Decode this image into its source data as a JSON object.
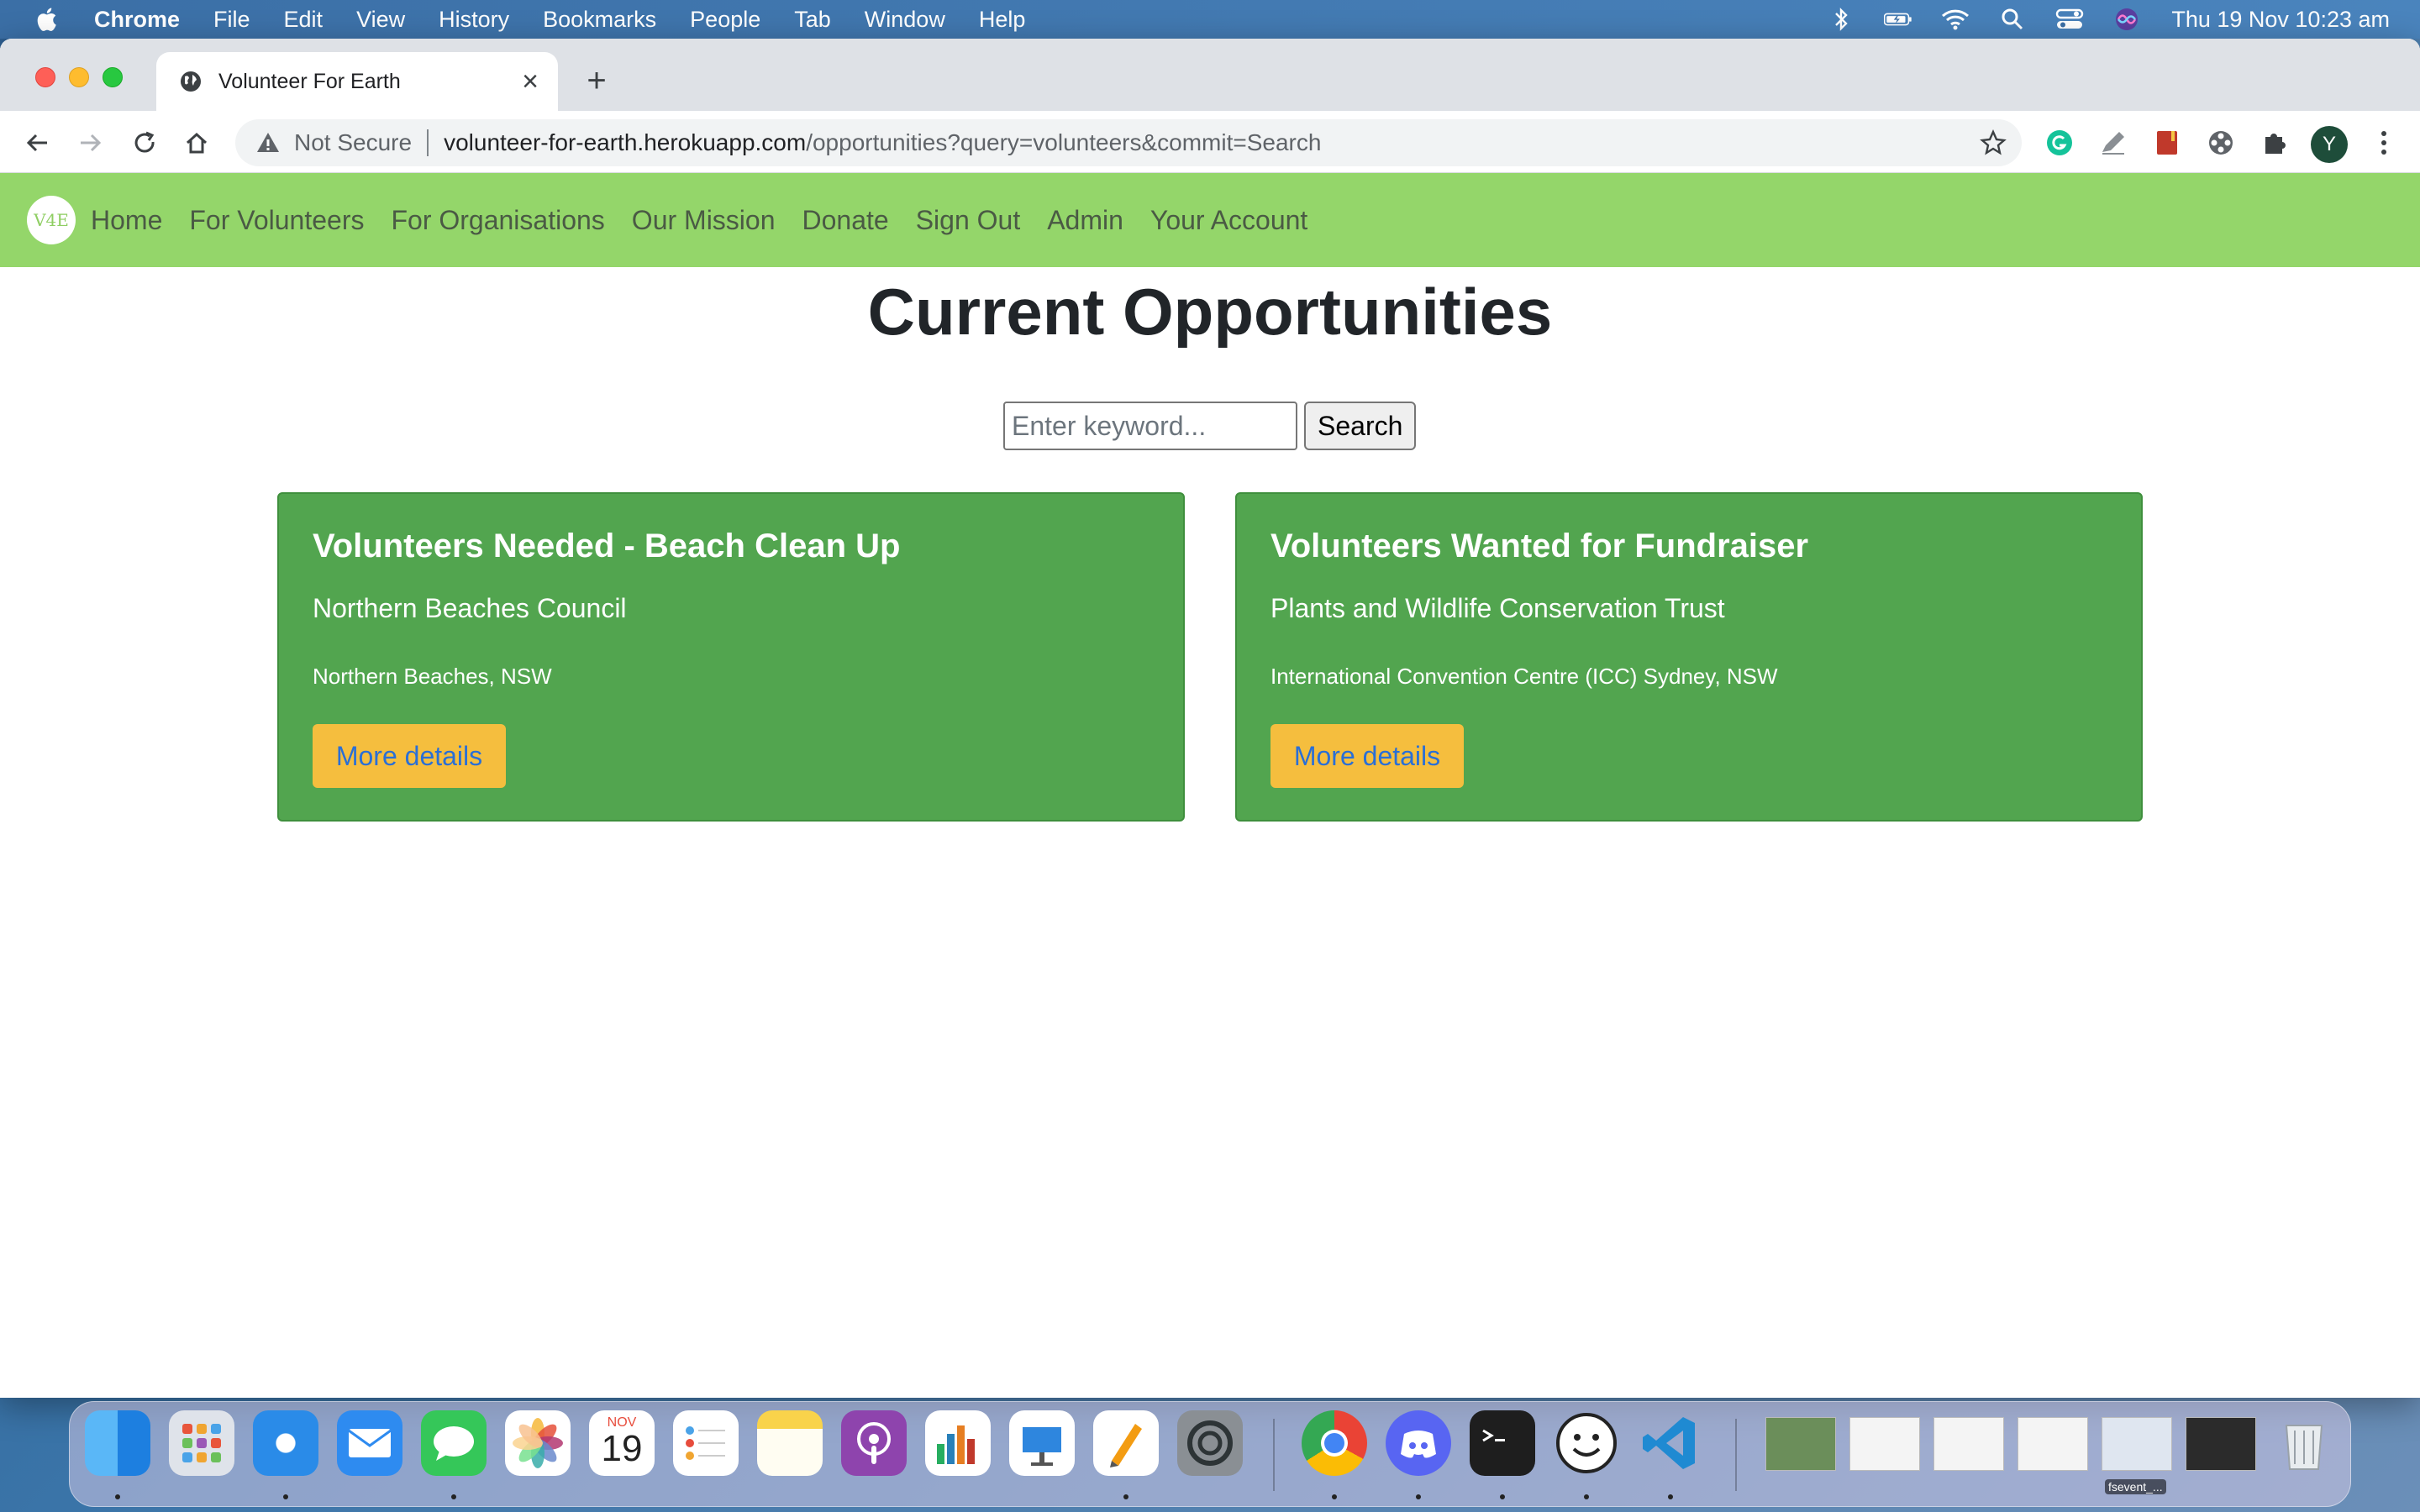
{
  "menubar": {
    "app_name": "Chrome",
    "items": [
      "File",
      "Edit",
      "View",
      "History",
      "Bookmarks",
      "People",
      "Tab",
      "Window",
      "Help"
    ],
    "clock": "Thu 19 Nov  10:23 am",
    "status_icons": [
      "bluetooth-icon",
      "battery-icon",
      "wifi-icon",
      "spotlight-icon",
      "control-center-icon",
      "siri-icon"
    ]
  },
  "browser": {
    "tab_title": "Volunteer For Earth",
    "security_label": "Not Secure",
    "url_host": "volunteer-for-earth.herokuapp.com",
    "url_path": "/opportunities?query=volunteers&commit=Search",
    "profile_initial": "Y"
  },
  "site": {
    "logo_text": "V4E",
    "nav": [
      "Home",
      "For Volunteers",
      "For Organisations",
      "Our Mission",
      "Donate",
      "Sign Out",
      "Admin",
      "Your Account"
    ]
  },
  "page": {
    "title": "Current Opportunities",
    "search_placeholder": "Enter keyword...",
    "search_button": "Search",
    "opportunities": [
      {
        "title": "Volunteers Needed - Beach Clean Up",
        "organisation": "Northern Beaches Council",
        "location": "Northern Beaches, NSW",
        "button": "More details"
      },
      {
        "title": "Volunteers Wanted for Fundraiser",
        "organisation": "Plants and Wildlife Conservation Trust",
        "location": "International Convention Centre (ICC) Sydney, NSW",
        "button": "More details"
      }
    ]
  },
  "dock": {
    "calendar_month": "NOV",
    "calendar_day": "19",
    "thumb_label": "fsevent_..."
  }
}
